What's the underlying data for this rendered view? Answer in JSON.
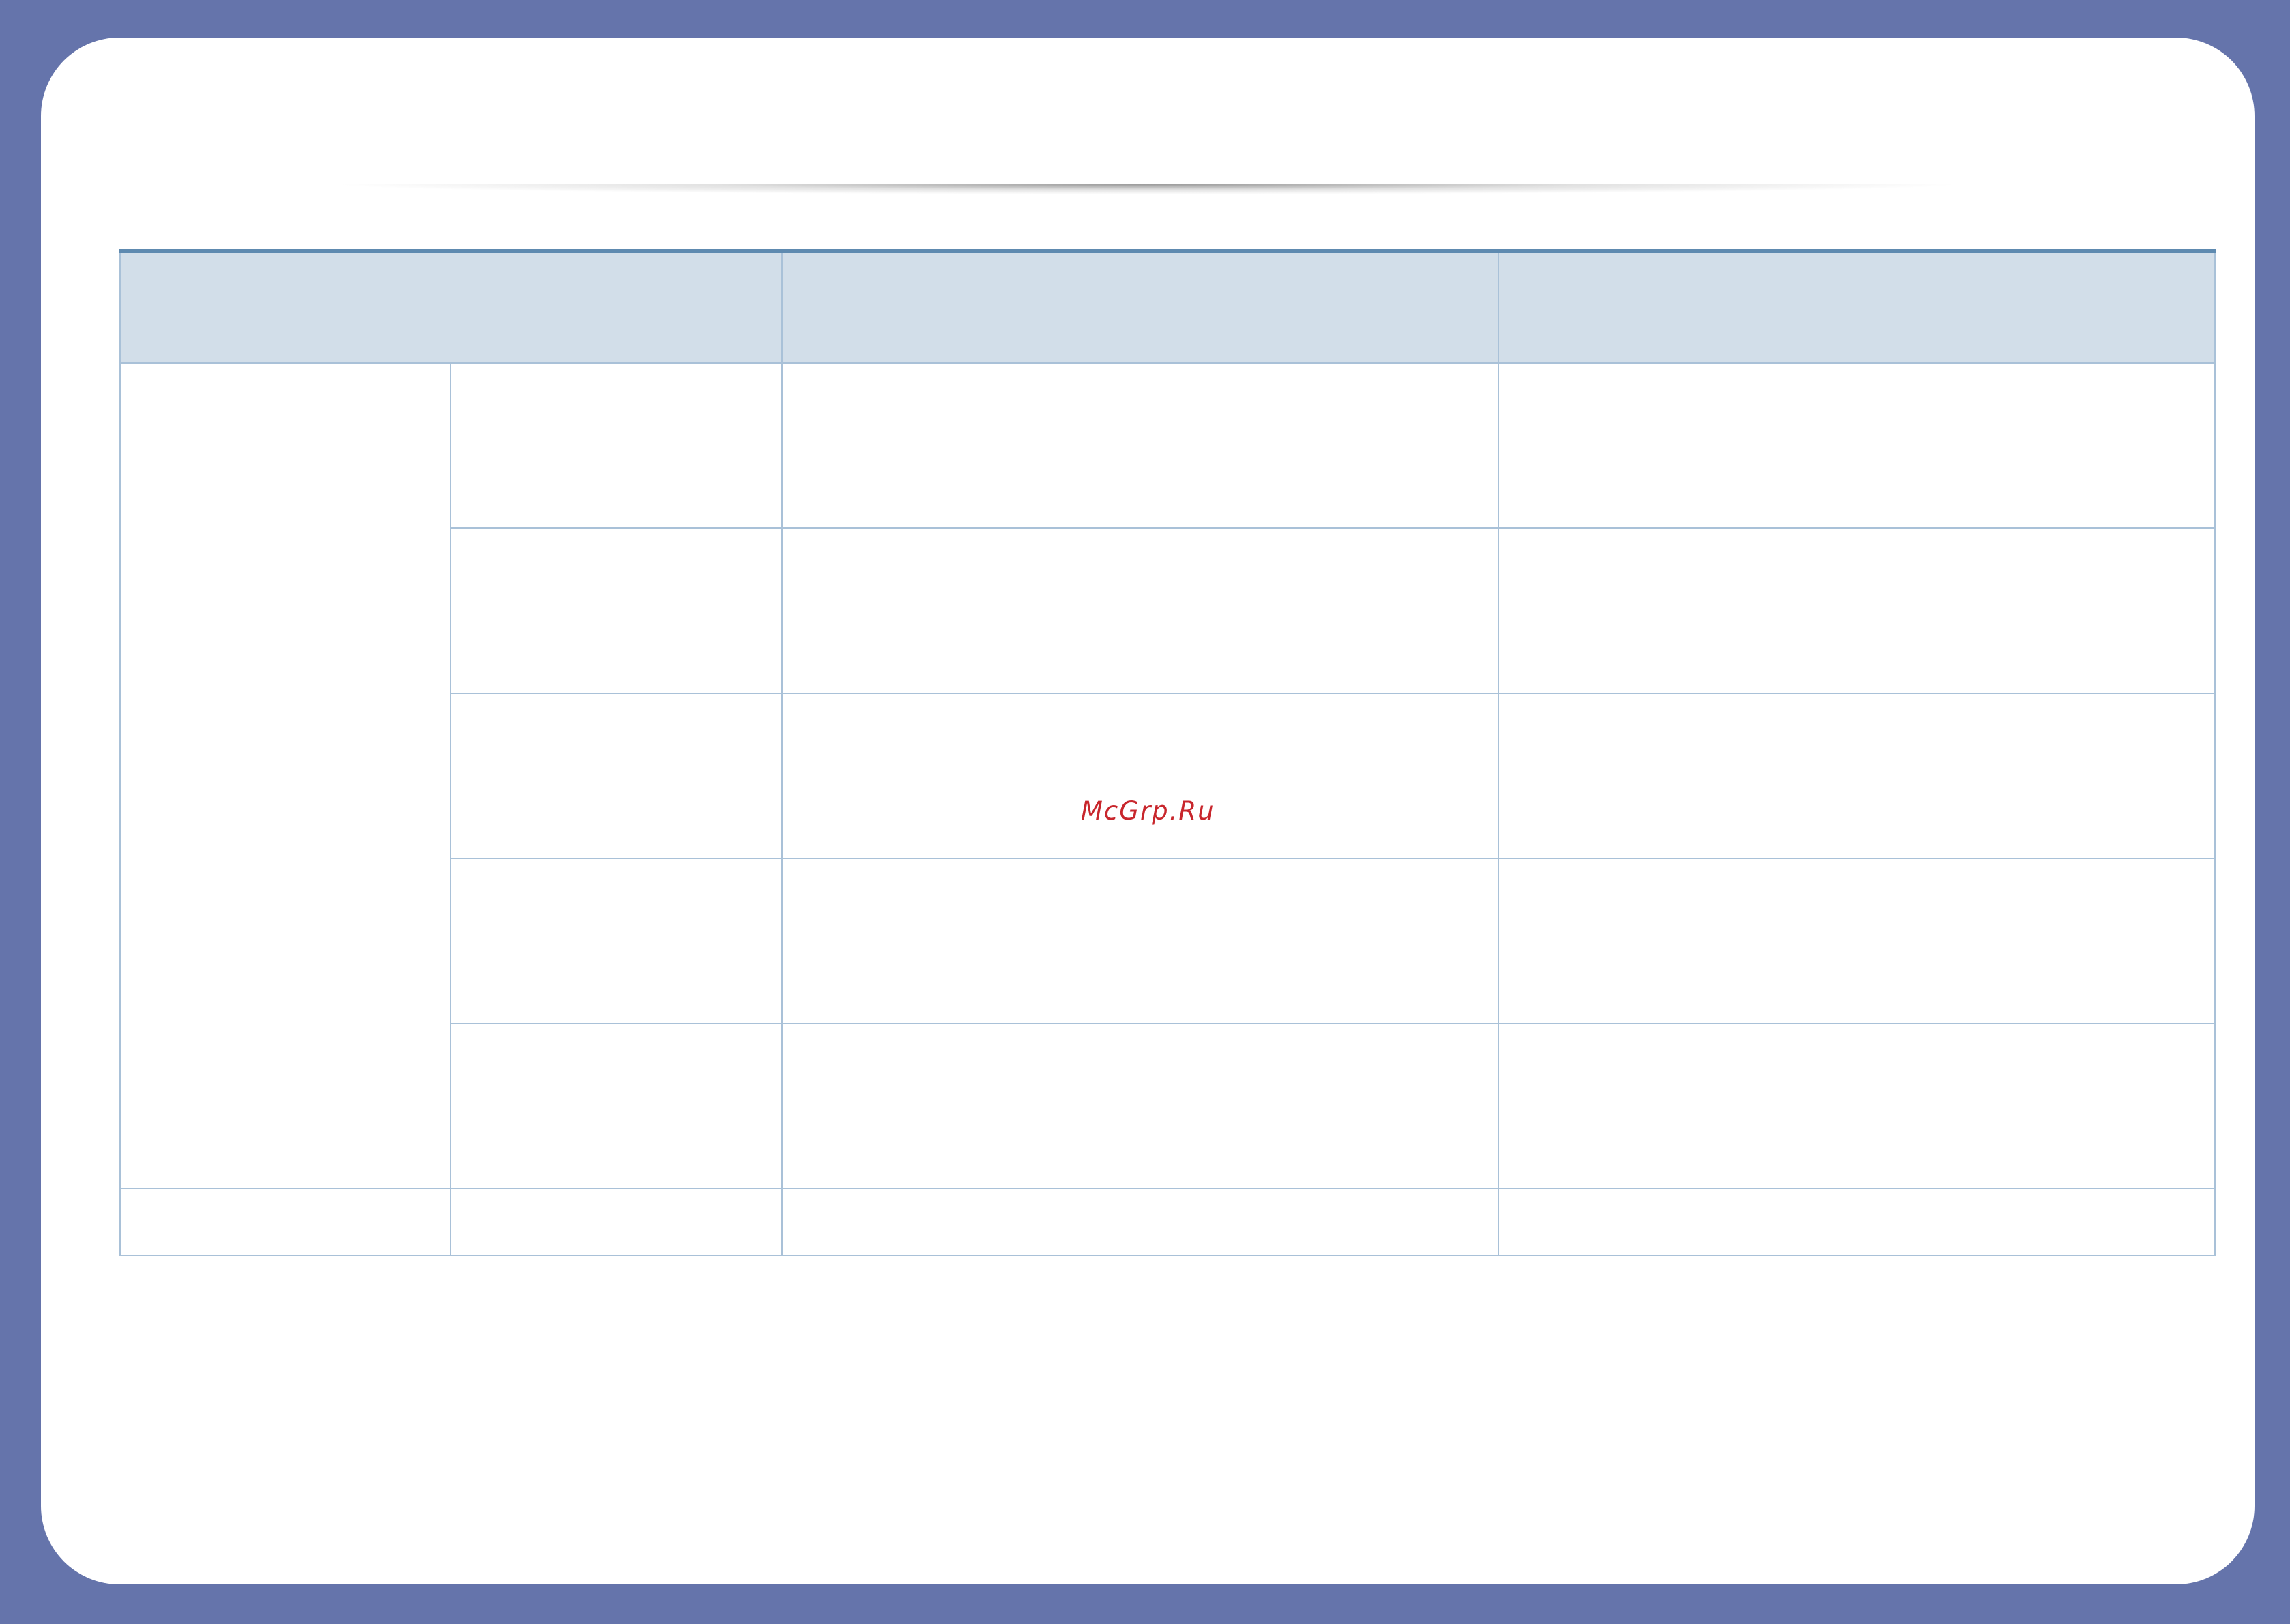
{
  "watermark": {
    "text": "McGrp.Ru",
    "color": "#c8262c"
  },
  "colors": {
    "frame": "#6574ab",
    "page": "#ffffff",
    "table_header": "#d2dee9",
    "table_rule": "#5e8ab0",
    "grid_line": "#a9c1d8"
  },
  "table": {
    "header": [
      "",
      "",
      ""
    ],
    "rows": [
      [
        "",
        "",
        "",
        ""
      ],
      [
        "",
        "",
        ""
      ],
      [
        "",
        "",
        ""
      ],
      [
        "",
        "",
        ""
      ],
      [
        "",
        "",
        ""
      ],
      [
        "",
        "",
        "",
        ""
      ]
    ]
  }
}
